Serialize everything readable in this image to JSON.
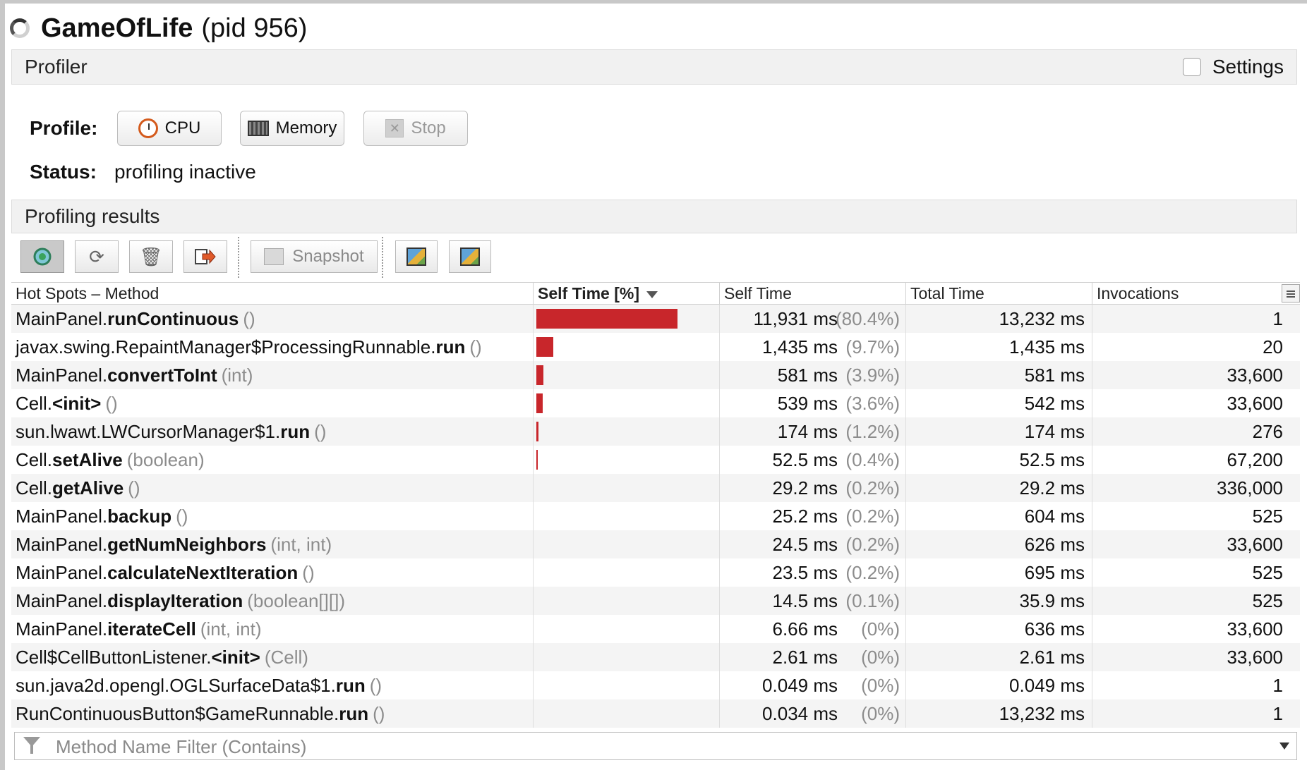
{
  "window": {
    "app_name": "GameOfLife",
    "pid": "(pid 956)"
  },
  "profiler": {
    "header": "Profiler",
    "settings_label": "Settings",
    "profile_label": "Profile:",
    "buttons": {
      "cpu": "CPU",
      "memory": "Memory",
      "stop": "Stop"
    },
    "status_label": "Status:",
    "status_value": "profiling inactive"
  },
  "results": {
    "header": "Profiling results",
    "toolbar": {
      "snapshot": "Snapshot"
    },
    "columns": {
      "method": "Hot Spots – Method",
      "self_time_pct": "Self Time [%]",
      "self_time": "Self Time",
      "total_time": "Total Time",
      "invocations": "Invocations"
    },
    "rows": [
      {
        "cls": "MainPanel.",
        "name": "runContinuous",
        "args": "()",
        "self_frac": 0.804,
        "self_time": "11,931 ms",
        "self_pct": "(80.4%)",
        "total_time": "13,232 ms",
        "invocations": "1"
      },
      {
        "cls": "javax.swing.RepaintManager$ProcessingRunnable.",
        "name": "run",
        "args": "()",
        "self_frac": 0.097,
        "self_time": "1,435 ms",
        "self_pct": "(9.7%)",
        "total_time": "1,435 ms",
        "invocations": "20"
      },
      {
        "cls": "MainPanel.",
        "name": "convertToInt",
        "args": "(int)",
        "self_frac": 0.039,
        "self_time": "581 ms",
        "self_pct": "(3.9%)",
        "total_time": "581 ms",
        "invocations": "33,600"
      },
      {
        "cls": "Cell.",
        "name": "<init>",
        "args": "()",
        "self_frac": 0.036,
        "self_time": "539 ms",
        "self_pct": "(3.6%)",
        "total_time": "542 ms",
        "invocations": "33,600"
      },
      {
        "cls": "sun.lwawt.LWCursorManager$1.",
        "name": "run",
        "args": "()",
        "self_frac": 0.012,
        "self_time": "174 ms",
        "self_pct": "(1.2%)",
        "total_time": "174 ms",
        "invocations": "276"
      },
      {
        "cls": "Cell.",
        "name": "setAlive",
        "args": "(boolean)",
        "self_frac": 0.004,
        "self_time": "52.5 ms",
        "self_pct": "(0.4%)",
        "total_time": "52.5 ms",
        "invocations": "67,200"
      },
      {
        "cls": "Cell.",
        "name": "getAlive",
        "args": "()",
        "self_frac": 0.002,
        "self_time": "29.2 ms",
        "self_pct": "(0.2%)",
        "total_time": "29.2 ms",
        "invocations": "336,000"
      },
      {
        "cls": "MainPanel.",
        "name": "backup",
        "args": "()",
        "self_frac": 0.002,
        "self_time": "25.2 ms",
        "self_pct": "(0.2%)",
        "total_time": "604 ms",
        "invocations": "525"
      },
      {
        "cls": "MainPanel.",
        "name": "getNumNeighbors",
        "args": "(int, int)",
        "self_frac": 0.002,
        "self_time": "24.5 ms",
        "self_pct": "(0.2%)",
        "total_time": "626 ms",
        "invocations": "33,600"
      },
      {
        "cls": "MainPanel.",
        "name": "calculateNextIteration",
        "args": "()",
        "self_frac": 0.002,
        "self_time": "23.5 ms",
        "self_pct": "(0.2%)",
        "total_time": "695 ms",
        "invocations": "525"
      },
      {
        "cls": "MainPanel.",
        "name": "displayIteration",
        "args": "(boolean[][])",
        "self_frac": 0.001,
        "self_time": "14.5 ms",
        "self_pct": "(0.1%)",
        "total_time": "35.9 ms",
        "invocations": "525"
      },
      {
        "cls": "MainPanel.",
        "name": "iterateCell",
        "args": "(int, int)",
        "self_frac": 0.0,
        "self_time": "6.66 ms",
        "self_pct": "(0%)",
        "total_time": "636 ms",
        "invocations": "33,600"
      },
      {
        "cls": "Cell$CellButtonListener.",
        "name": "<init>",
        "args": "(Cell)",
        "self_frac": 0.0,
        "self_time": "2.61 ms",
        "self_pct": "(0%)",
        "total_time": "2.61 ms",
        "invocations": "33,600"
      },
      {
        "cls": "sun.java2d.opengl.OGLSurfaceData$1.",
        "name": "run",
        "args": "()",
        "self_frac": 0.0,
        "self_time": "0.049 ms",
        "self_pct": "(0%)",
        "total_time": "0.049 ms",
        "invocations": "1"
      },
      {
        "cls": "RunContinuousButton$GameRunnable.",
        "name": "run",
        "args": "()",
        "self_frac": 0.0,
        "self_time": "0.034 ms",
        "self_pct": "(0%)",
        "total_time": "13,232 ms",
        "invocations": "1"
      }
    ],
    "filter": {
      "placeholder": "Method Name Filter (Contains)"
    }
  },
  "colors": {
    "bar": "#c8262b",
    "header_bg": "#f1f1f1",
    "row_alt_bg": "#f4f4f4"
  }
}
